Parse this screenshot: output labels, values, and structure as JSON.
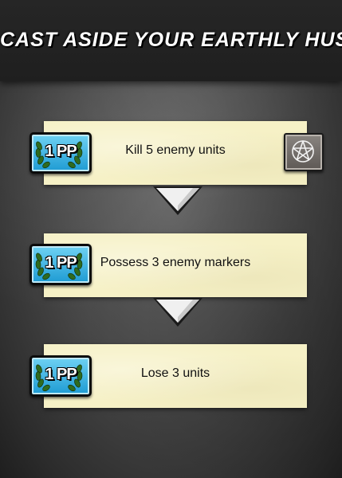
{
  "header": {
    "title": "CAST ASIDE YOUR EARTHLY HUSKS"
  },
  "steps": [
    {
      "badge": "1 PP",
      "text": "Kill 5 enemy units",
      "icon": "pentagram-icon"
    },
    {
      "badge": "1 PP",
      "text": "Possess 3 enemy markers"
    },
    {
      "badge": "1 PP",
      "text": "Lose 3 units"
    }
  ],
  "colors": {
    "badge_blue": "#1e9bd3",
    "step_yellow": "#f6f1c6",
    "laurel_green": "#2f6b1f",
    "header_dark": "#222222"
  }
}
